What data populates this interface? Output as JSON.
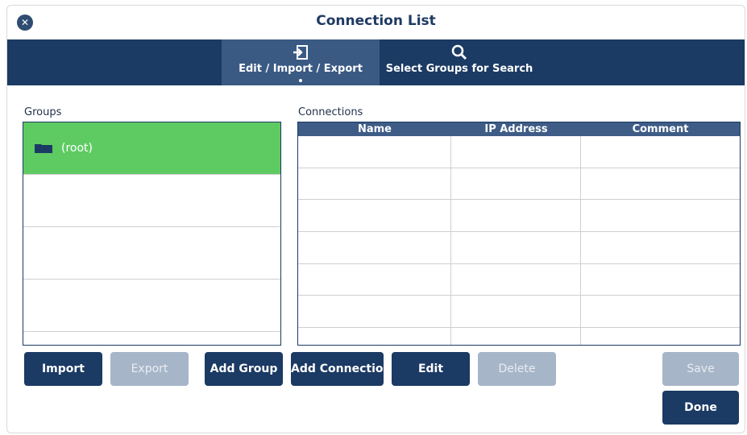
{
  "window": {
    "title": "Connection List"
  },
  "toolbar": {
    "tabs": [
      {
        "label": "Edit / Import / Export",
        "icon": "import-export-icon",
        "active": true
      },
      {
        "label": "Select Groups for Search",
        "icon": "search-icon",
        "active": false
      }
    ]
  },
  "groups": {
    "label": "Groups",
    "items": [
      {
        "name": "(root)",
        "icon": "folder-icon",
        "selected": true
      },
      {
        "name": "",
        "selected": false
      },
      {
        "name": "",
        "selected": false
      },
      {
        "name": "",
        "selected": false
      }
    ]
  },
  "connections": {
    "label": "Connections",
    "columns": [
      "Name",
      "IP Address",
      "Comment"
    ],
    "rows": []
  },
  "buttons": {
    "import": "Import",
    "export": "Export",
    "add_group": "Add Group",
    "add_connection": "Add Connection",
    "edit": "Edit",
    "delete": "Delete",
    "save": "Save",
    "done": "Done"
  },
  "colors": {
    "accent": "#1b3a64",
    "selected_row": "#5ecb62",
    "disabled_button": "#a7b5c8"
  }
}
